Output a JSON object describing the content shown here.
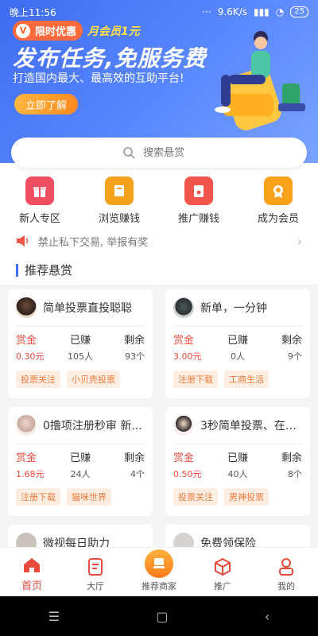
{
  "status_bar": {
    "time": "晚上11:56",
    "speed": "9.6K/s",
    "battery": "25"
  },
  "hero": {
    "badge": "限时优惠",
    "badge_icon": "V",
    "promo": "月会员1元",
    "title": "发布任务,免服务费",
    "subtitle": "打造国内最大、最高效的互助平台!",
    "cta": "立即了解"
  },
  "search": {
    "placeholder": "搜索悬赏"
  },
  "quick_links": [
    {
      "label": "新人专区",
      "icon": "gift-icon",
      "color": "#ee4f63"
    },
    {
      "label": "浏览赚钱",
      "icon": "book-icon",
      "color": "#f3a21e"
    },
    {
      "label": "推广赚钱",
      "icon": "envelope-icon",
      "color": "#f0564c"
    },
    {
      "label": "成为会员",
      "icon": "member-badge-icon",
      "color": "#f8a21c"
    }
  ],
  "notice": {
    "text": "禁止私下交易, 举报有奖"
  },
  "section": {
    "title": "推荐悬赏"
  },
  "stat_labels": {
    "reward": "赏金",
    "earned": "已赚",
    "remaining": "剩余"
  },
  "tasks": [
    {
      "title": "简单投票直投聪聪",
      "reward": "0.30元",
      "earned": "105人",
      "remaining": "93个",
      "tags": [
        "投票关注",
        "小贝壳投票"
      ]
    },
    {
      "title": "新单，一分钟",
      "reward": "3.00元",
      "earned": "0人",
      "remaining": "9个",
      "tags": [
        "注册下载",
        "工商生活"
      ]
    },
    {
      "title": "0撸项注册秒审 新...",
      "reward": "1.68元",
      "earned": "24人",
      "remaining": "4个",
      "tags": [
        "注册下载",
        "猫咪世界"
      ]
    },
    {
      "title": "3秒简单投票、在线...",
      "reward": "0.50元",
      "earned": "40人",
      "remaining": "8个",
      "tags": [
        "投票关注",
        "男神投票"
      ]
    },
    {
      "title": "微视每日助力",
      "reward": "",
      "earned": "",
      "remaining": "",
      "tags": []
    },
    {
      "title": "免费领保险",
      "reward": "",
      "earned": "",
      "remaining": "",
      "tags": []
    }
  ],
  "bottom_nav": [
    {
      "label": "首页",
      "icon": "home-icon",
      "active": true
    },
    {
      "label": "大厅",
      "icon": "document-icon",
      "active": false
    },
    {
      "label": "推荐商家",
      "icon": "merchant-icon",
      "active": false
    },
    {
      "label": "推广",
      "icon": "cube-icon",
      "active": false
    },
    {
      "label": "我的",
      "icon": "user-icon",
      "active": false
    }
  ],
  "colors": {
    "primary_blue": "#3f6cf0",
    "accent_red": "#e84a3c",
    "tag_orange": "#f07a3a"
  }
}
